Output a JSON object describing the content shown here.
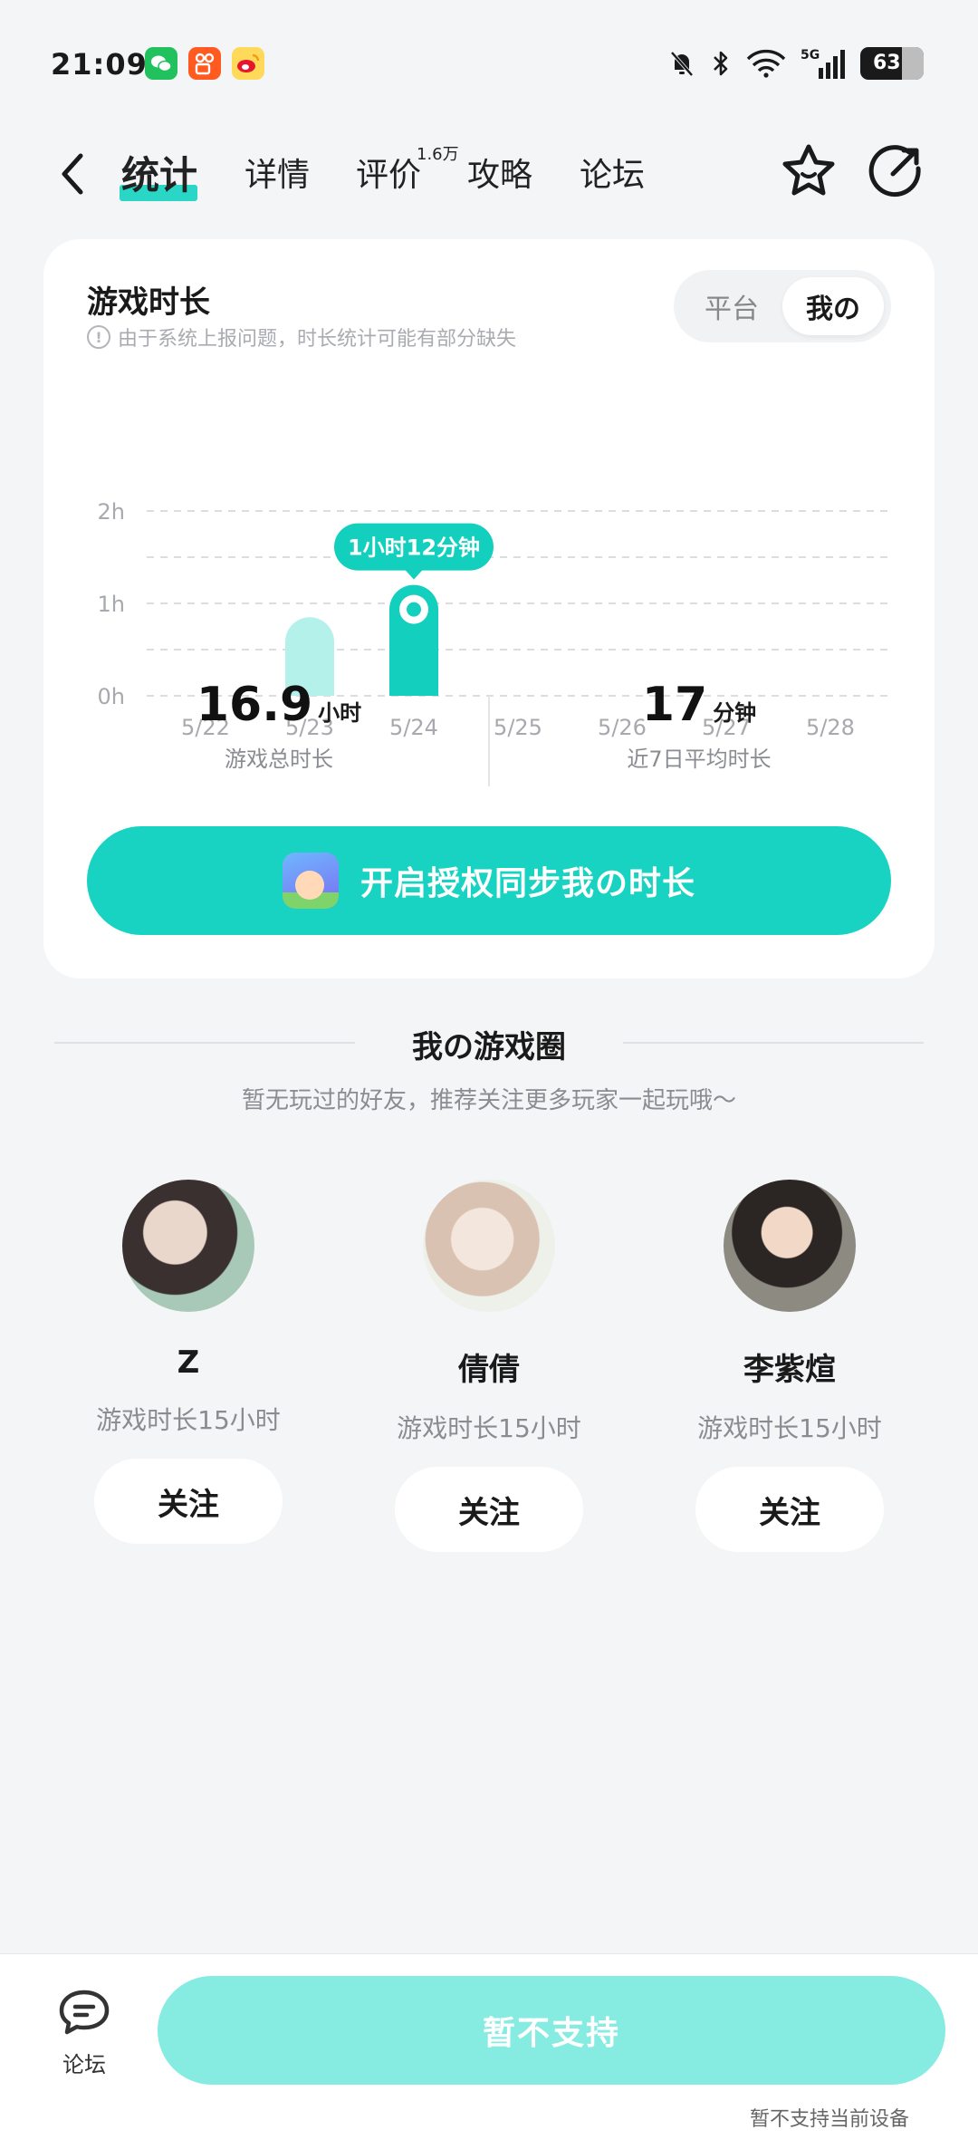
{
  "status_bar": {
    "time": "21:09",
    "apps": [
      "wechat-icon",
      "kuaishou-icon",
      "weibo-icon"
    ],
    "network": "5G",
    "battery": "63"
  },
  "nav": {
    "tabs": [
      "统计",
      "详情",
      "评价",
      "攻略",
      "论坛"
    ],
    "active_tab": "统计",
    "review_count": "1.6万"
  },
  "playtime_card": {
    "title": "游戏时长",
    "note": "由于系统上报问题，时长统计可能有部分缺失",
    "toggle": {
      "platform": "平台",
      "mine": "我の",
      "selected": "我の"
    },
    "tooltip": "1小时12分钟",
    "total": {
      "value": "16.9",
      "unit": "小时",
      "label": "游戏总时长"
    },
    "avg": {
      "value": "17",
      "unit": "分钟",
      "label": "近7日平均时长"
    },
    "sync_button": "开启授权同步我の时长"
  },
  "chart_data": {
    "type": "bar",
    "categories": [
      "5/22",
      "5/23",
      "5/24",
      "5/25",
      "5/26",
      "5/27",
      "5/28"
    ],
    "values": [
      0,
      0.85,
      1.2,
      0,
      0,
      0,
      0
    ],
    "highlight_index": 2,
    "y_ticks": [
      "0h",
      "1h",
      "2h"
    ],
    "ylim": [
      0,
      2
    ],
    "grid": true,
    "colors": {
      "bar": "#b3f1ea",
      "highlight": "#13cfbd"
    }
  },
  "game_circle": {
    "title": "我の游戏圈",
    "subtitle": "暂无玩过的好友，推荐关注更多玩家一起玩哦～",
    "friends": [
      {
        "name": "Z",
        "playtime": "游戏时长15小时",
        "follow": "关注"
      },
      {
        "name": "倩倩",
        "playtime": "游戏时长15小时",
        "follow": "关注"
      },
      {
        "name": "李紫煊",
        "playtime": "游戏时长15小时",
        "follow": "关注"
      }
    ]
  },
  "bottom_bar": {
    "forum_label": "论坛",
    "action_label": "暂不支持",
    "note": "暂不支持当前设备"
  },
  "colors": {
    "accent": "#18d3c1",
    "accent_light": "#86ece1",
    "background": "#f4f5f7"
  }
}
